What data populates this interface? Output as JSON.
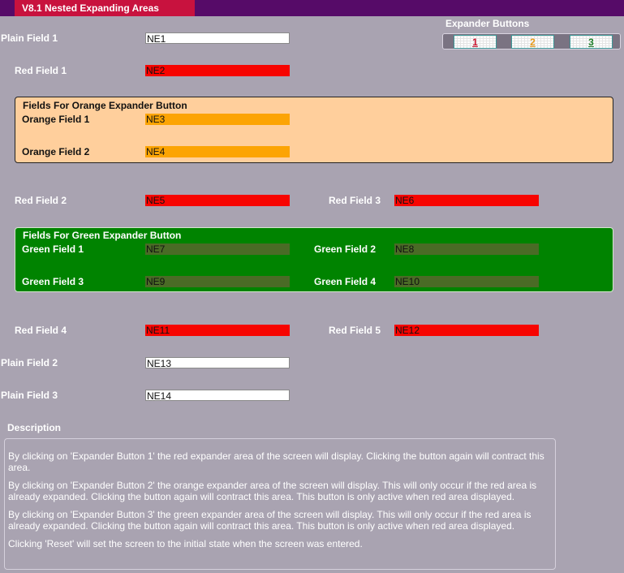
{
  "header": {
    "tab_label": "V8.1 Nested Expanding Areas"
  },
  "expander": {
    "title": "Expander Buttons",
    "buttons": [
      {
        "label": "1",
        "color": "#c8142e"
      },
      {
        "label": "2",
        "color": "#e69a1a"
      },
      {
        "label": "3",
        "color": "#1e7f2a"
      }
    ]
  },
  "fields": {
    "plain1": {
      "label": "Plain Field 1",
      "value": "NE1"
    },
    "red1": {
      "label": "Red Field 1",
      "value": "NE2"
    },
    "orange_title": "Fields For Orange Expander Button",
    "orange1": {
      "label": "Orange Field 1",
      "value": "NE3"
    },
    "orange2": {
      "label": "Orange Field 2",
      "value": "NE4"
    },
    "red2": {
      "label": "Red Field 2",
      "value": "NE5"
    },
    "red3": {
      "label": "Red Field 3",
      "value": "NE6"
    },
    "green_title": "Fields For Green Expander Button",
    "green1": {
      "label": "Green Field 1",
      "value": "NE7"
    },
    "green2": {
      "label": "Green Field 2",
      "value": "NE8"
    },
    "green3": {
      "label": "Green Field 3",
      "value": "NE9"
    },
    "green4": {
      "label": "Green Field 4",
      "value": "NE10"
    },
    "red4": {
      "label": "Red Field 4",
      "value": "NE11"
    },
    "red5": {
      "label": "Red Field 5",
      "value": "NE12"
    },
    "plain2": {
      "label": "Plain Field 2",
      "value": "NE13"
    },
    "plain3": {
      "label": "Plain Field 3",
      "value": "NE14"
    }
  },
  "description": {
    "title": "Description",
    "paragraphs": [
      "By clicking on 'Expander Button 1' the red expander area of the screen will display. Clicking the button again will contract this area.",
      "By clicking on 'Expander Button 2' the orange expander area of the screen will display. This will only occur if the red area is already expanded. Clicking the button again will contract this area. This button is only active when red area displayed.",
      "By clicking on 'Expander Button 3' the green expander area of the screen will display. This will only occur if the red area is already expanded. Clicking the button again will contract this area. This button is only active when red area displayed.",
      "Clicking 'Reset' will set the screen to the initial state when the screen was entered."
    ]
  },
  "colors": {
    "background": "#a9a3b1",
    "topbar": "#560b68",
    "tab": "#c8123e",
    "red_field": "#f70400",
    "orange_field": "#fca404",
    "orange_area": "#ffcf9c",
    "green_area": "#008300",
    "green_field": "#4a6b26"
  }
}
